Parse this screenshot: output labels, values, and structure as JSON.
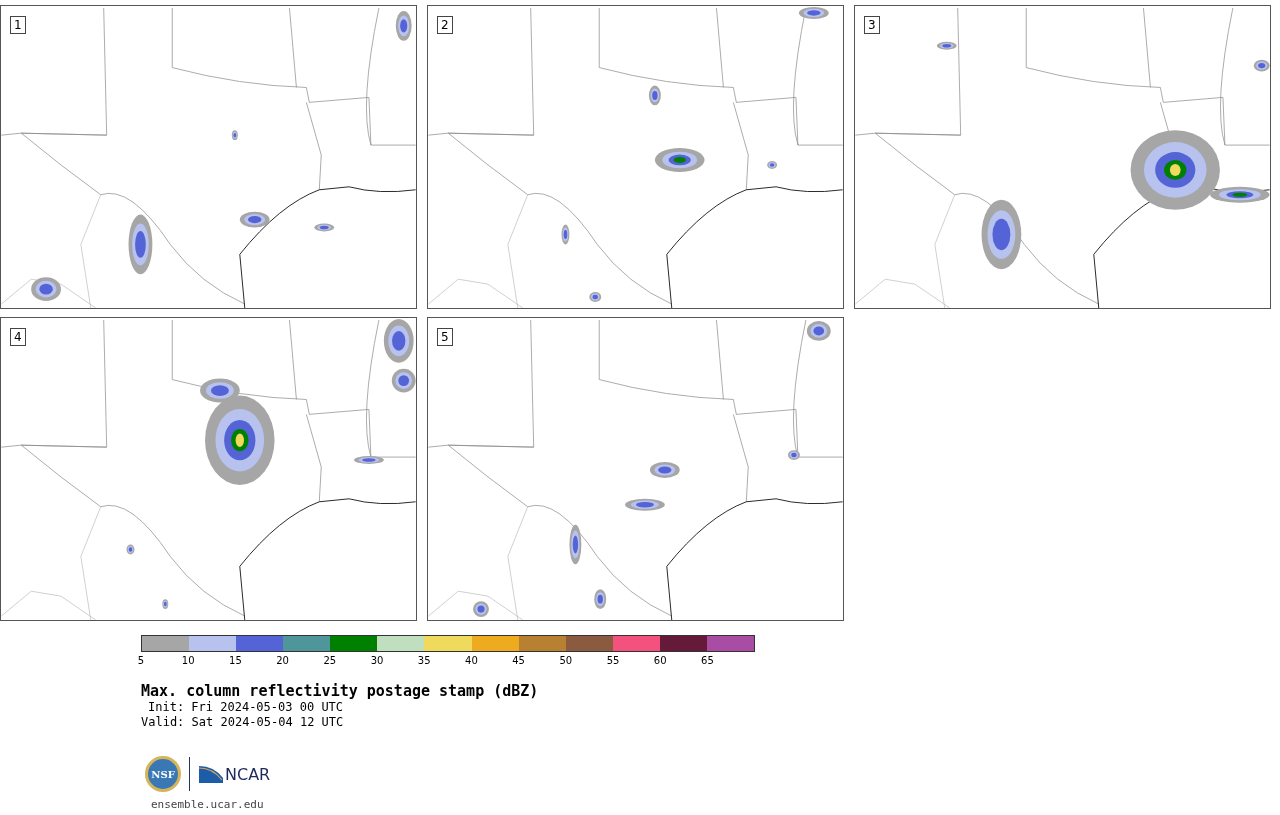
{
  "panels": [
    {
      "label": "1"
    },
    {
      "label": "2"
    },
    {
      "label": "3"
    },
    {
      "label": "4"
    },
    {
      "label": "5"
    }
  ],
  "colorbar": {
    "segments": [
      {
        "color": "#a6a6a6"
      },
      {
        "color": "#b8c2ee"
      },
      {
        "color": "#5463d6"
      },
      {
        "color": "#4e969a"
      },
      {
        "color": "#008000"
      },
      {
        "color": "#bfdfbf"
      },
      {
        "color": "#f0da5e"
      },
      {
        "color": "#efab1f"
      },
      {
        "color": "#b88131"
      },
      {
        "color": "#8a5b3f"
      },
      {
        "color": "#f4527e"
      },
      {
        "color": "#661a3a"
      },
      {
        "color": "#a94ca4"
      }
    ],
    "ticks": [
      "5",
      "10",
      "15",
      "20",
      "25",
      "30",
      "35",
      "40",
      "45",
      "50",
      "55",
      "60",
      "65"
    ]
  },
  "title": "Max. column reflectivity postage stamp (dBZ)",
  "init": "Init: Fri 2024-05-03 00 UTC",
  "valid": "Valid: Sat 2024-05-04 12 UTC",
  "logo": {
    "left": "NSF",
    "right": "NCAR"
  },
  "site": "ensemble.ucar.edu"
}
